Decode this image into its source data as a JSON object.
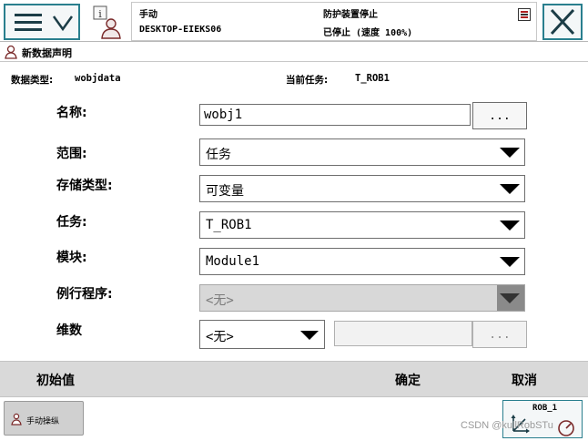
{
  "status": {
    "mode": "手动",
    "host": "DESKTOP-EIEKS06",
    "guard": "防护装置停止",
    "state": "已停止 (速度 100%)"
  },
  "title": "新数据声明",
  "info": {
    "dtype_label": "数据类型:",
    "dtype_value": "wobjdata",
    "task_label": "当前任务:",
    "task_value": "T_ROB1"
  },
  "form": {
    "name_label": "名称:",
    "name_value": "wobj1",
    "name_btn": "...",
    "scope_label": "范围:",
    "scope_value": "任务",
    "storage_label": "存储类型:",
    "storage_value": "可变量",
    "task_label": "任务:",
    "task_value": "T_ROB1",
    "module_label": "模块:",
    "module_value": "Module1",
    "routine_label": "例行程序:",
    "routine_value": "<无>",
    "dim_label": "维数",
    "dim_value": "<无>",
    "dim_btn": "..."
  },
  "actions": {
    "initial": "初始值",
    "ok": "确定",
    "cancel": "取消"
  },
  "taskbar": {
    "jog_label": "手动操纵",
    "robot_label": "ROB_1"
  },
  "watermark": "CSDN @kullRobSTu"
}
